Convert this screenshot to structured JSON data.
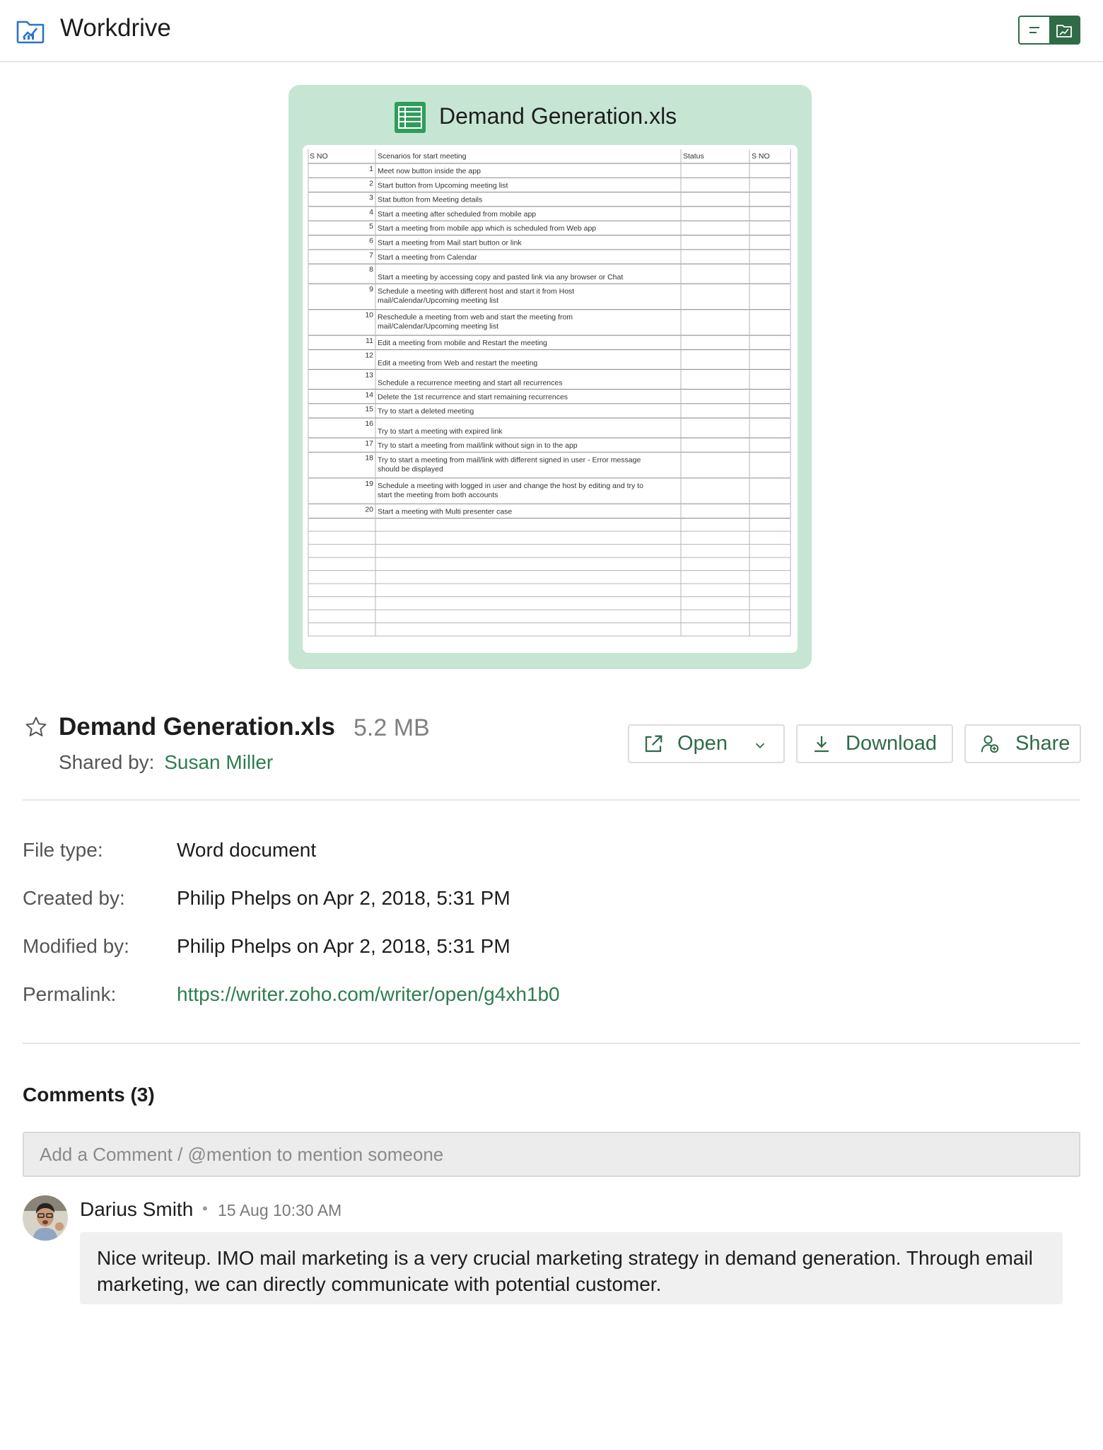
{
  "app": {
    "title": "Workdrive",
    "logo_icon": "folder-chart-icon",
    "view_toggle": [
      "list-view-icon",
      "preview-view-icon"
    ]
  },
  "colors": {
    "accent": "#2f6b47",
    "link": "#2e7d4f",
    "preview_bg": "#c6e6d3",
    "sheet_icon": "#2e9d5b"
  },
  "preview": {
    "file_name": "Demand Generation.xls",
    "icon": "spreadsheet-icon",
    "sheet": {
      "headers": [
        "S NO",
        "Scenarios for start meeting",
        "Status",
        "S NO"
      ],
      "rows": [
        {
          "no": "1",
          "text": [
            "Meet now button inside the app"
          ]
        },
        {
          "no": "2",
          "text": [
            "Start button from Upcoming meeting list"
          ]
        },
        {
          "no": "3",
          "text": [
            "Stat button from Meeting details"
          ]
        },
        {
          "no": "4",
          "text": [
            "Start a meeting after scheduled from mobile app"
          ]
        },
        {
          "no": "5",
          "text": [
            "Start a meeting from mobile app which is scheduled from Web app"
          ]
        },
        {
          "no": "6",
          "text": [
            "Start a meeting from Mail start button or link"
          ]
        },
        {
          "no": "7",
          "text": [
            "Start a meeting from Calendar"
          ]
        },
        {
          "no": "8",
          "text": [
            "Start a meeting by accessing copy and pasted link via any browser or Chat"
          ]
        },
        {
          "no": "9",
          "text": [
            "Schedule a meeting with different host and start it from Host",
            "mail/Calendar/Upcoming meeting list"
          ]
        },
        {
          "no": "10",
          "text": [
            "Reschedule a meeting from web and start the meeting from",
            "mail/Calendar/Upcoming meeting list"
          ]
        },
        {
          "no": "11",
          "text": [
            "Edit a meeting from mobile and Restart the meeting"
          ]
        },
        {
          "no": "12",
          "text": [
            "Edit a meeting from Web and restart the meeting"
          ]
        },
        {
          "no": "13",
          "text": [
            "Schedule a recurrence meeting and start all recurrences"
          ]
        },
        {
          "no": "14",
          "text": [
            "Delete the 1st recurrence and start remaining recurrences"
          ]
        },
        {
          "no": "15",
          "text": [
            "Try to start a deleted meeting"
          ]
        },
        {
          "no": "16",
          "text": [
            "Try to start a meeting with expired link"
          ]
        },
        {
          "no": "17",
          "text": [
            "Try to start a meeting from mail/link without sign in to the app"
          ]
        },
        {
          "no": "18",
          "text": [
            "Try to start a meeting from mail/link with different signed in user - Error message",
            "should be displayed"
          ]
        },
        {
          "no": "19",
          "text": [
            "Schedule a meeting with logged in user and change the host by editing and try to",
            "start the meeting from both accounts"
          ]
        },
        {
          "no": "20",
          "text": [
            "Start a meeting with Multi presenter case"
          ]
        }
      ]
    }
  },
  "file": {
    "name": "Demand Generation.xls",
    "size": "5.2 MB",
    "shared_label": "Shared by:",
    "shared_by": "Susan Miller",
    "favorite_icon": "star-icon"
  },
  "actions": {
    "open": {
      "label": "Open",
      "icon": "external-link-icon",
      "menu_icon": "chevron-down-icon"
    },
    "download": {
      "label": "Download",
      "icon": "download-icon"
    },
    "share": {
      "label": "Share",
      "icon": "share-user-icon"
    }
  },
  "properties": [
    {
      "label": "File type:",
      "value": "Word document"
    },
    {
      "label": "Created by:",
      "value": "Philip Phelps on Apr 2, 2018, 5:31 PM"
    },
    {
      "label": "Modified by:",
      "value": "Philip Phelps on Apr 2, 2018, 5:31 PM"
    },
    {
      "label": "Permalink:",
      "value": "https://writer.zoho.com/writer/open/g4xh1b0"
    }
  ],
  "comments": {
    "title": "Comments (3)",
    "input_placeholder": "Add a Comment / @mention to mention someone",
    "items": [
      {
        "author": "Darius Smith",
        "separator": "•",
        "time": "15 Aug 10:30 AM",
        "avatar_icon": "user-avatar-icon",
        "text": "Nice writeup. IMO mail marketing is a very crucial marketing strategy in demand generation. Through email marketing, we can directly communicate with potential customer."
      }
    ]
  }
}
